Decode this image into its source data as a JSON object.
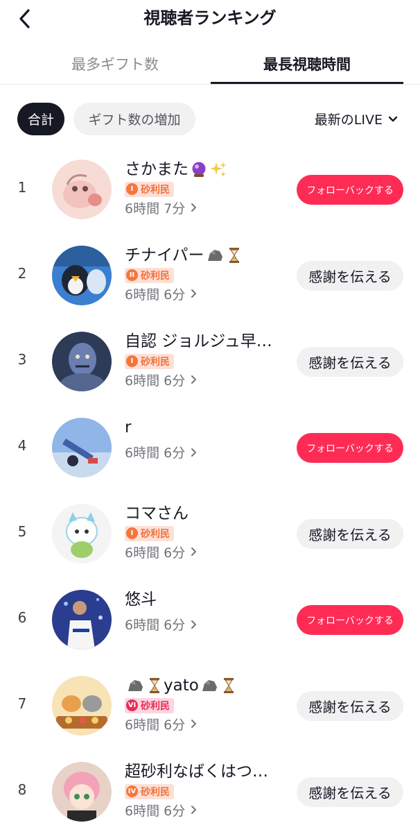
{
  "header": {
    "title": "視聴者ランキング"
  },
  "tabs": [
    {
      "label": "最多ギフト数"
    },
    {
      "label": "最長視聴時間"
    }
  ],
  "filters": {
    "total_label": "合計",
    "gift_increase_label": "ギフト数の増加",
    "sort_label": "最新のLIVE"
  },
  "badge_label": "砂利民",
  "viewers": [
    {
      "rank": "1",
      "name": "さかまた",
      "duration": "6時間 7分",
      "action": "フォローバックする"
    },
    {
      "rank": "2",
      "name": "チナイパー",
      "duration": "6時間 6分",
      "action": "感謝を伝える"
    },
    {
      "rank": "3",
      "name": "自認 ジョルジュ早…",
      "duration": "6時間 6分",
      "action": "感謝を伝える"
    },
    {
      "rank": "4",
      "name": "r",
      "duration": "6時間 6分",
      "action": "フォローバックする"
    },
    {
      "rank": "5",
      "name": "コマさん",
      "duration": "6時間 6分",
      "action": "感謝を伝える"
    },
    {
      "rank": "6",
      "name": "悠斗",
      "duration": "6時間 6分",
      "action": "フォローバックする"
    },
    {
      "rank": "7",
      "name": "yato",
      "duration": "6時間 6分",
      "action": "感謝を伝える"
    },
    {
      "rank": "8",
      "name": "超砂利なばくはつ…",
      "duration": "6時間 6分",
      "action": "感謝を伝える"
    }
  ],
  "badges": {
    "1": {
      "level": "I"
    },
    "2": {
      "level": "II"
    },
    "3": {
      "level": "I"
    },
    "5": {
      "level": "I"
    },
    "7": {
      "level": "VI"
    },
    "8": {
      "level": "IV"
    }
  },
  "colors": {
    "follow_button": "#fe2c55",
    "thanks_button": "#f1f1f2",
    "active_chip": "#161823",
    "badge_orange": "#f4763d",
    "badge_red": "#ea2d55"
  }
}
